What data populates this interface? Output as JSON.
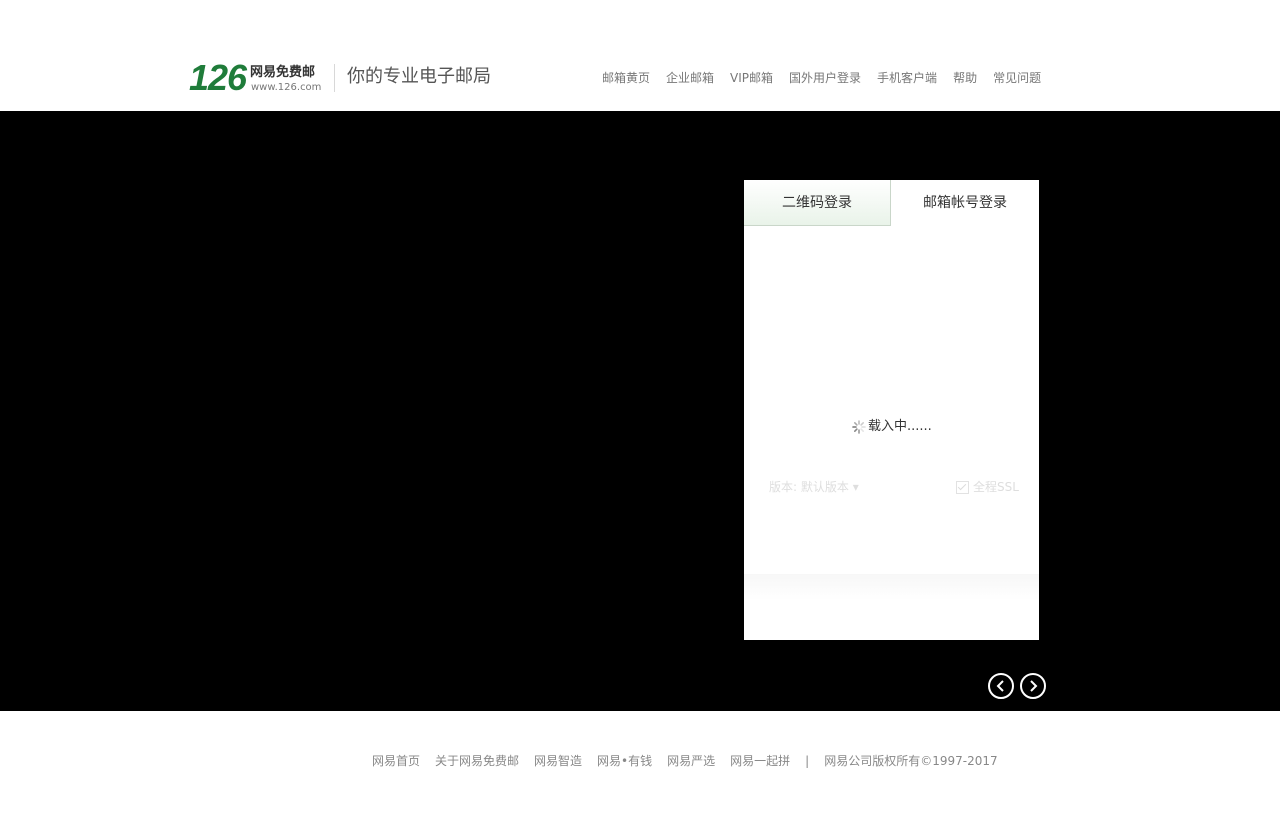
{
  "header": {
    "logo_number": "126",
    "logo_name": "网易免费邮",
    "logo_url": "www.126.com",
    "slogan": "你的专业电子邮局",
    "nav": [
      "邮箱黄页",
      "企业邮箱",
      "VIP邮箱",
      "国外用户登录",
      "手机客户端",
      "帮助",
      "常见问题"
    ]
  },
  "login": {
    "tab_qr": "二维码登录",
    "tab_account": "邮箱帐号登录",
    "loading_text": "载入中......",
    "version_label": "版本: 默认版本",
    "ssl_label": "全程SSL"
  },
  "banner": {
    "prev_icon": "chevron-left-icon",
    "next_icon": "chevron-right-icon"
  },
  "footer": {
    "links": [
      "网易首页",
      "关于网易免费邮",
      "网易智造",
      "网易•有钱",
      "网易严选",
      "网易一起拼"
    ],
    "separator": "|",
    "copyright": "网易公司版权所有©1997-2017"
  },
  "colors": {
    "brand_green": "#1f7c3a",
    "banner_bg": "#000000"
  }
}
